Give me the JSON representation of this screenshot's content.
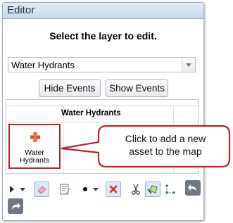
{
  "window": {
    "title": "Editor"
  },
  "prompt": "Select the layer to edit.",
  "layer_select": {
    "value": "Water Hydrants"
  },
  "buttons": {
    "hide_events": "Hide Events",
    "show_events": "Show Events"
  },
  "template_picker": {
    "header": "Water Hydrants",
    "items": [
      {
        "label_line1": "Water",
        "label_line2": "Hydrants",
        "icon": "hydrant-cross-icon"
      }
    ]
  },
  "toolbar": {
    "tools": [
      "select-arrow-icon",
      "eraser-icon",
      "attributes-icon",
      "point-icon",
      "delete-icon",
      "cut-icon",
      "reshape-icon",
      "vertices-icon",
      "undo-icon",
      "redo-icon"
    ]
  },
  "callout": {
    "line1": "Click to add a new",
    "line2": "asset to the map"
  },
  "colors": {
    "highlight": "#c0202a",
    "hydrant": "#e2502b",
    "titlebar": "#c9d8ea"
  }
}
